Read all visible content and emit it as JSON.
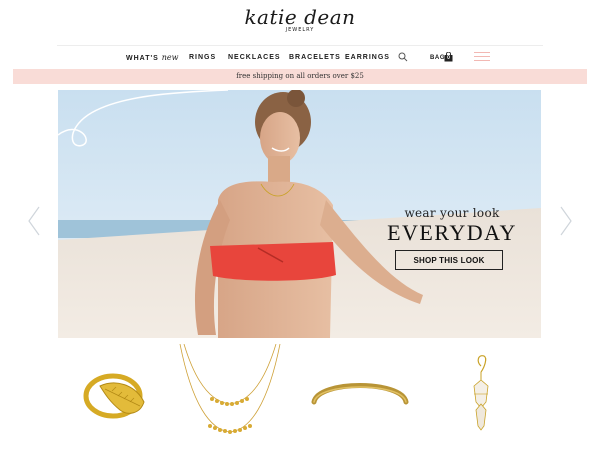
{
  "header": {
    "logo_script": "katie dean",
    "logo_sub": "JEWELRY"
  },
  "nav": {
    "whats_prefix": "WHAT'S",
    "whats_script": "new",
    "rings": "RINGS",
    "necklaces": "NECKLACES",
    "bracelets": "BRACELETS",
    "earrings": "EARRINGS",
    "bag_label": "BAG",
    "bag_count": "0"
  },
  "icons": {
    "search": "search-icon",
    "bag": "shopping-bag-icon",
    "menu": "hamburger-menu-icon",
    "prev": "chevron-left-icon",
    "next": "chevron-right-icon"
  },
  "promo": {
    "text": "free shipping on all orders over $25"
  },
  "hero": {
    "line1": "wear your look",
    "line2": "EVERYDAY",
    "button": "SHOP THIS LOOK"
  },
  "colors": {
    "promo_bg": "#f9dcd7",
    "menu_accent": "#f2b8b3",
    "gold": "#c9a227",
    "swimsuit": "#e8453c"
  }
}
